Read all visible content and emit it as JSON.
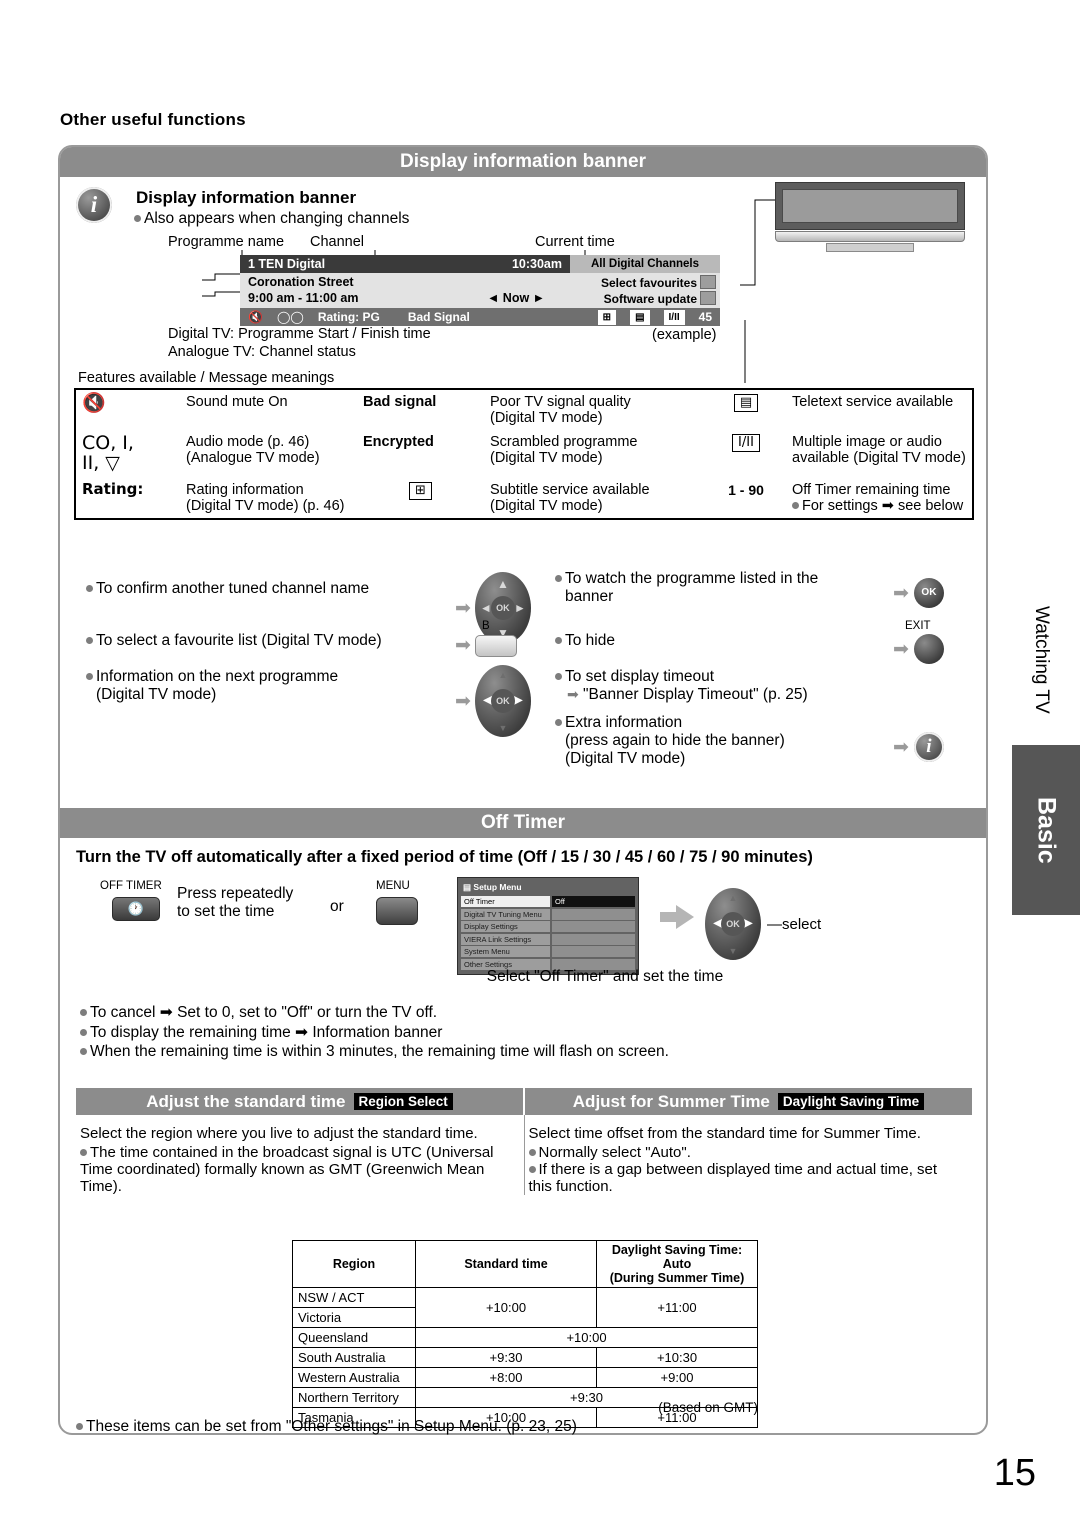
{
  "page": {
    "heading": "Other useful functions",
    "number": "15"
  },
  "tabs": {
    "vertical": "Watching TV",
    "chapter": "Basic"
  },
  "section1": {
    "bar_title": "Display information banner",
    "title": "Display information banner",
    "bullet": "Also appears when changing channels",
    "callouts": {
      "programme_name": "Programme name",
      "channel": "Channel",
      "current_time": "Current time",
      "start_finish": "Digital TV: Programme Start / Finish time",
      "channel_status": "Analogue TV: Channel status",
      "example": "(example)"
    },
    "banner": {
      "channel": "1 TEN Digital",
      "time": "10:30am",
      "all_channels": "All Digital Channels",
      "programme": "Coronation Street",
      "airtime": "9:00 am - 11:00 am",
      "now": "◄ Now ►",
      "select_favourites": "Select favourites",
      "software_update": "Software update",
      "rating": "Rating: PG",
      "bad_signal": "Bad Signal",
      "icon_subtitle": "subtitle-icon",
      "icon_teletext": "teletext-icon",
      "icon_audio": "I/II",
      "timer": "45"
    },
    "features_label": "Features available / Message meanings",
    "features": [
      {
        "icon": "mute-icon",
        "icon_text": "🔇",
        "desc": "Sound mute On",
        "mid_label": "Bad signal",
        "mid_bold": true,
        "mid_desc": "Poor TV signal quality",
        "mid_desc2": "(Digital TV mode)",
        "right_icon": "teletext-icon",
        "right_icon_text": "▤",
        "right_desc": "Teletext service available",
        "right_desc2": ""
      },
      {
        "icon": "audio-mode-icon",
        "icon_text": "CO, I,",
        "icon_text2": "II, ▽",
        "desc": "Audio mode (p. 46)",
        "desc2": "(Analogue TV mode)",
        "mid_label": "Encrypted",
        "mid_bold": true,
        "mid_desc": "Scrambled programme",
        "mid_desc2": "(Digital TV mode)",
        "right_icon": "multi-audio-icon",
        "right_icon_text": "I/II",
        "right_desc": "Multiple image or audio",
        "right_desc2": "available (Digital TV mode)"
      },
      {
        "icon": "rating-label",
        "icon_text": "Rating:",
        "icon_bold": true,
        "desc": "Rating information",
        "desc2": "(Digital TV mode) (p. 46)",
        "mid_label": "subtitle-icon",
        "mid_is_icon": true,
        "mid_icon_text": "⊞",
        "mid_desc": "Subtitle service available",
        "mid_desc2": "(Digital TV mode)",
        "right_icon": "range-1-90",
        "right_icon_text": "1 - 90",
        "right_desc": "Off Timer remaining time",
        "right_desc2": "For settings ➡ see below"
      }
    ],
    "actions": [
      {
        "text": "To confirm another tuned channel name",
        "control": "dpad-updown"
      },
      {
        "text": "To select a favourite list (Digital TV mode)",
        "control": "b-button",
        "control_label": "B"
      },
      {
        "text": "Information on the next programme",
        "text2": "(Digital TV mode)",
        "control": "dpad-leftright"
      }
    ],
    "actions_right": [
      {
        "text": "To watch the programme listed in the",
        "text2": "banner",
        "control": "ok-button",
        "control_label": "OK"
      },
      {
        "text": "To hide",
        "control": "exit-button",
        "control_label": "EXIT"
      },
      {
        "text": "To set display timeout",
        "sub": "\"Banner Display Timeout\" (p. 25)"
      },
      {
        "text": "Extra information",
        "text2": "(press again to hide the banner)",
        "text3": "(Digital TV mode)",
        "control": "info-button"
      }
    ]
  },
  "section2": {
    "bar_title": "Off Timer",
    "heading": "Turn the TV off automatically after a fixed period of time (Off / 15 / 30 / 45 / 60 / 75 / 90 minutes)",
    "off_timer_label": "OFF TIMER",
    "press_text": "Press repeatedly",
    "press_text2": "to set the time",
    "or": "or",
    "menu_label": "MENU",
    "setup_menu": {
      "title": "Setup Menu",
      "rows": [
        {
          "name": "Off Timer",
          "value": "Off",
          "selected": true
        },
        {
          "name": "Digital TV Tuning Menu",
          "value": ""
        },
        {
          "name": "Display Settings",
          "value": ""
        },
        {
          "name": "VIERA Link Settings",
          "value": ""
        },
        {
          "name": "System Menu",
          "value": ""
        },
        {
          "name": "Other Settings",
          "value": ""
        }
      ]
    },
    "select_label": "select",
    "caption": "Select \"Off Timer\" and set the time",
    "notes": [
      "To cancel ➡ Set to 0, set to \"Off\" or turn the TV off.",
      "To display the remaining time ➡ Information banner",
      "When the remaining time is within 3 minutes, the remaining time will flash on screen."
    ]
  },
  "section3": {
    "left": {
      "title": "Adjust the standard time",
      "badge": "Region Select",
      "body": "Select the region where you live to adjust the standard time.",
      "bullets": [
        "The time contained in the broadcast signal is UTC (Universal Time coordinated) formally known as GMT (Greenwich Mean Time)."
      ]
    },
    "right": {
      "title": "Adjust for Summer Time",
      "badge": "Daylight Saving Time",
      "body": "Select time offset from the standard time for Summer Time.",
      "bullets": [
        "Normally select \"Auto\".",
        "If there is a gap between displayed time and actual time, set this function."
      ]
    },
    "table": {
      "headers": [
        "Region",
        "Standard time",
        "Daylight Saving Time: Auto (During Summer Time)"
      ],
      "header_dst_line1": "Daylight Saving Time: Auto",
      "header_dst_line2": "(During Summer Time)",
      "rows": [
        {
          "region": "NSW / ACT",
          "standard": "+10:00",
          "dst": "+11:00",
          "span_standard": 2,
          "span_dst": 2
        },
        {
          "region": "Victoria"
        },
        {
          "region": "Queensland",
          "both": "+10:00"
        },
        {
          "region": "South Australia",
          "standard": "+9:30",
          "dst": "+10:30"
        },
        {
          "region": "Western Australia",
          "standard": "+8:00",
          "dst": "+9:00"
        },
        {
          "region": "Northern Territory",
          "both": "+9:30"
        },
        {
          "region": "Tasmania",
          "standard": "+10:00",
          "dst": "+11:00"
        }
      ],
      "footnote": "(Based on GMT)"
    },
    "final_note": "These items can be set from \"Other settings\" in Setup Menu. (p. 23, 25)"
  }
}
